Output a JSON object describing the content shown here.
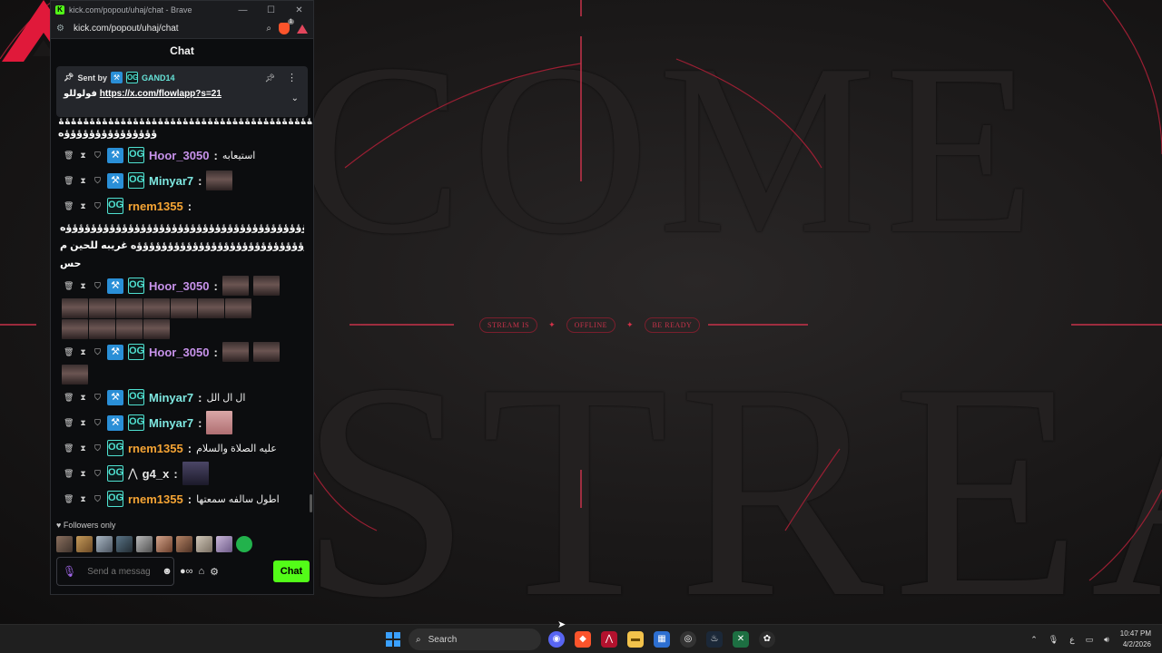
{
  "window": {
    "title": "kick.com/popout/uhaj/chat - Brave",
    "url": "kick.com/popout/uhaj/chat",
    "min_label": "—",
    "max_label": "☐",
    "close_label": "✕"
  },
  "chat": {
    "header": "Chat",
    "pinned": {
      "sent_by_label": "Sent by",
      "sender": "GAND14",
      "text_prefix": "فولوللو",
      "link": "https://x.com/flowlapp?s=21"
    },
    "overflow_line": "ؤؤؤؤؤؤؤؤؤؤؤؤؤؤؤؤؤؤؤؤؤؤؤؤؤؤؤؤؤؤؤؤؤؤؤؤؤؤؤؤؤؤ",
    "overflow_line2": "ؤؤؤؤؤؤؤؤؤؤؤؤؤؤؤه",
    "messages": [
      {
        "user": "Hoor_3050",
        "text": "استيعابه"
      },
      {
        "user": "Minyar7",
        "text": ""
      },
      {
        "user": "rnem1355",
        "text": ""
      },
      {
        "user": "Hoor_3050",
        "text": ""
      },
      {
        "user": "Hoor_3050",
        "text": ""
      },
      {
        "user": "Minyar7",
        "text": "ال ال الل"
      },
      {
        "user": "Minyar7",
        "text": ""
      },
      {
        "user": "rnem1355",
        "text": "عليه الصلاة والسلام"
      },
      {
        "user": "g4_x",
        "text": ""
      },
      {
        "user": "rnem1355",
        "text": "اطول سالفه سمعتها"
      }
    ],
    "rnem_long_1": "ؤؤؤؤؤؤؤؤؤؤؤؤؤؤؤؤؤؤؤؤؤؤؤؤؤؤؤؤؤؤؤؤؤؤؤؤؤؤؤؤؤؤؤه",
    "rnem_long_2": "ؤؤؤؤؤؤؤؤؤؤؤؤؤؤؤؤؤؤؤؤؤؤؤؤؤؤؤؤؤؤؤؤؤؤؤه غريبه للحين م",
    "rnem_long_3": "حس",
    "followers_only": "Followers only",
    "input_placeholder": "Send a message",
    "chat_button": "Chat"
  },
  "stream": {
    "pills": [
      "STREAM IS",
      "OFFLINE",
      "BE READY"
    ],
    "word_top": "COME",
    "word_bottom": "STREA"
  },
  "taskbar": {
    "search_label": "Search",
    "time": "10:47 PM",
    "date": "4/2/2026",
    "lang": "ع"
  },
  "colors": {
    "kick_green": "#53fc18",
    "accent_red": "#d33148",
    "username_purple": "#c792ea",
    "username_teal": "#7ee7e0",
    "username_orange": "#f5a434"
  }
}
